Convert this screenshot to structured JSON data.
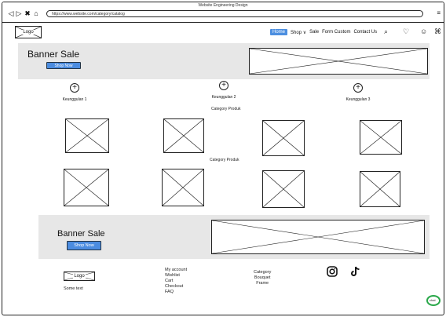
{
  "browser": {
    "window_title": "Website Engineering Design",
    "url": "https://www.website.com/category/catalog",
    "back_icon": "back-arrow-icon",
    "forward_icon": "forward-arrow-icon",
    "close_icon": "close-x-icon",
    "home_icon": "home-icon",
    "menu_icon": "hamburger-menu-icon"
  },
  "header": {
    "logo": "Logo",
    "nav": [
      {
        "label": "Home",
        "active": true
      },
      {
        "label": "Shop ∨",
        "active": false
      },
      {
        "label": "Sale",
        "active": false
      },
      {
        "label": "Form Custom",
        "active": false
      },
      {
        "label": "Contact Us",
        "active": false
      }
    ],
    "icons": [
      "search-icon",
      "heart-icon",
      "user-icon",
      "cart-icon"
    ]
  },
  "banner_top": {
    "title": "Banner Sale",
    "button": "Shop Now"
  },
  "features": [
    {
      "label": "Keunggulan 1"
    },
    {
      "label": "Keunggulan 2"
    },
    {
      "label": "Keunggulan 3"
    }
  ],
  "category_labels": [
    "Category Produk",
    "Category Produk"
  ],
  "banner_bottom": {
    "title": "Banner Sale",
    "button": "Shop Now"
  },
  "footer": {
    "logo": "Logo",
    "tagline": "Some text",
    "links": [
      "My account",
      "Wishlist",
      "Cart",
      "Checkout",
      "FAQ"
    ],
    "categories": [
      "Category",
      "Bouquet",
      "Frame"
    ],
    "social_icons": [
      "instagram-icon",
      "tiktok-icon"
    ],
    "chat_label": "chat"
  },
  "colors": {
    "accent": "#4b8ce0",
    "banner_bg": "#e7e7e7",
    "chat": "#2aa84a"
  }
}
